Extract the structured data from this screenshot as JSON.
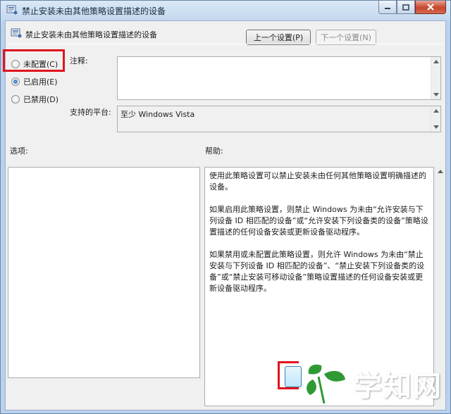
{
  "window": {
    "title": "禁止安装未由其他策略设置描述的设备"
  },
  "header": {
    "policy_title": "禁止安装未由其他策略设置描述的设备",
    "prev_button": "上一个设置(P)",
    "next_button": "下一个设置(N)"
  },
  "state": {
    "options": [
      {
        "label": "未配置(C)",
        "checked": false
      },
      {
        "label": "已启用(E)",
        "checked": true
      },
      {
        "label": "已禁用(D)",
        "checked": false
      }
    ]
  },
  "comment": {
    "label": "注释:",
    "value": ""
  },
  "platform": {
    "label": "支持的平台:",
    "value": "至少 Windows Vista"
  },
  "options_section": {
    "label": "选项:"
  },
  "help_section": {
    "label": "帮助:",
    "paragraphs": [
      "使用此策略设置可以禁止安装未由任何其他策略设置明确描述的设备。",
      "如果启用此策略设置，则禁止 Windows 为未由“允许安装与下列设备 ID 相匹配的设备”或“允许安装下列设备类的设备”策略设置描述的任何设备安装或更新设备驱动程序。",
      "如果禁用或未配置此策略设置，则允许 Windows 为未由“禁止安装与下列设备 ID 相匹配的设备”、“禁止安装下列设备类的设备”或“禁止安装可移动设备”策略设置描述的任何设备安装或更新设备驱动程序。"
    ]
  },
  "watermark": {
    "text": "学知网"
  },
  "colors": {
    "highlight": "#e0141e",
    "accent": "#1b5fa6"
  }
}
